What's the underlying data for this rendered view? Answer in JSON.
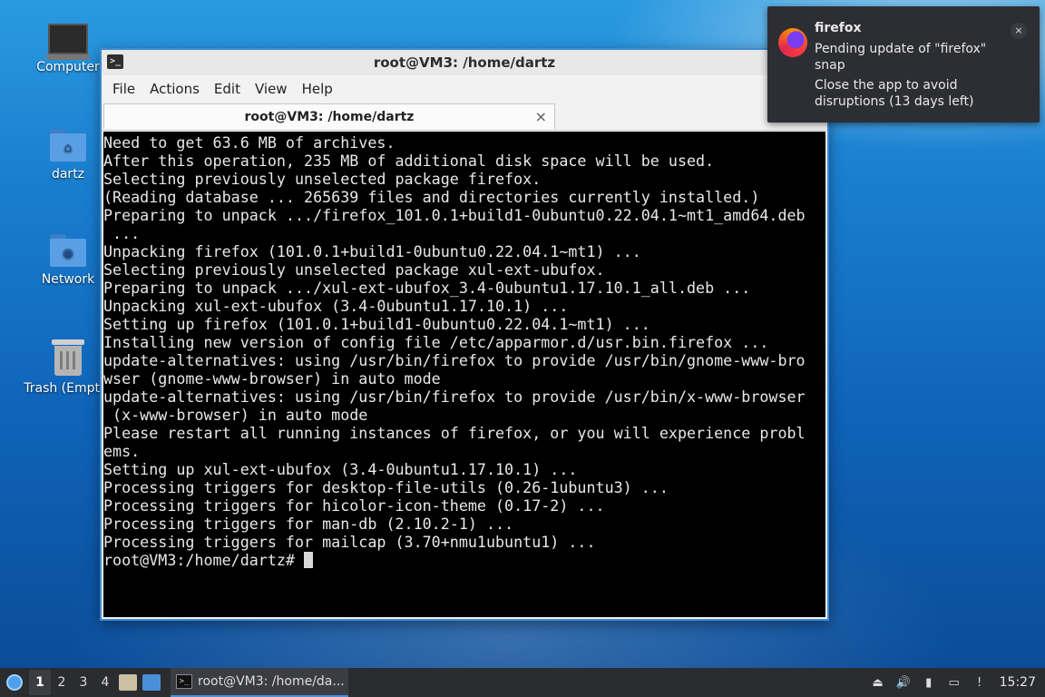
{
  "desktop": {
    "icons": [
      {
        "label": "Computer"
      },
      {
        "label": "dartz"
      },
      {
        "label": "Network"
      },
      {
        "label": "Trash (Empty)"
      }
    ]
  },
  "window": {
    "title": "root@VM3: /home/dartz",
    "menu": [
      "File",
      "Actions",
      "Edit",
      "View",
      "Help"
    ],
    "tab_label": "root@VM3: /home/dartz",
    "terminal_lines": [
      "Need to get 63.6 MB of archives.",
      "After this operation, 235 MB of additional disk space will be used.",
      "Selecting previously unselected package firefox.",
      "(Reading database ... 265639 files and directories currently installed.)",
      "Preparing to unpack .../firefox_101.0.1+build1-0ubuntu0.22.04.1~mt1_amd64.deb",
      " ...",
      "Unpacking firefox (101.0.1+build1-0ubuntu0.22.04.1~mt1) ...",
      "Selecting previously unselected package xul-ext-ubufox.",
      "Preparing to unpack .../xul-ext-ubufox_3.4-0ubuntu1.17.10.1_all.deb ...",
      "Unpacking xul-ext-ubufox (3.4-0ubuntu1.17.10.1) ...",
      "Setting up firefox (101.0.1+build1-0ubuntu0.22.04.1~mt1) ...",
      "Installing new version of config file /etc/apparmor.d/usr.bin.firefox ...",
      "update-alternatives: using /usr/bin/firefox to provide /usr/bin/gnome-www-bro",
      "wser (gnome-www-browser) in auto mode",
      "update-alternatives: using /usr/bin/firefox to provide /usr/bin/x-www-browser",
      " (x-www-browser) in auto mode",
      "Please restart all running instances of firefox, or you will experience probl",
      "ems.",
      "Setting up xul-ext-ubufox (3.4-0ubuntu1.17.10.1) ...",
      "Processing triggers for desktop-file-utils (0.26-1ubuntu3) ...",
      "Processing triggers for hicolor-icon-theme (0.17-2) ...",
      "Processing triggers for man-db (2.10.2-1) ...",
      "Processing triggers for mailcap (3.70+nmu1ubuntu1) ..."
    ],
    "prompt": "root@VM3:/home/dartz# "
  },
  "notification": {
    "app": "firefox",
    "line1": "Pending update of \"firefox\" snap",
    "line2": "Close the app to avoid disruptions (13 days left)",
    "close_glyph": "×"
  },
  "taskbar": {
    "workspaces": [
      "1",
      "2",
      "3",
      "4"
    ],
    "active_workspace": "1",
    "task_label": "root@VM3: /home/da...",
    "clock": "15:27"
  },
  "colors": {
    "accent": "#3d8ad3",
    "terminal_bg": "#000000",
    "panel_bg": "#2b2c30"
  }
}
